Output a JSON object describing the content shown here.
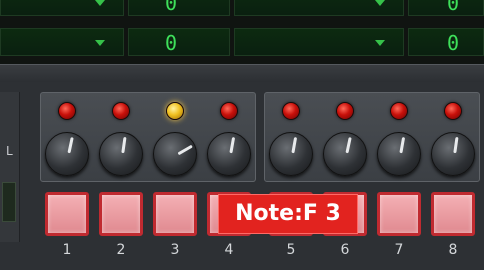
{
  "display": {
    "rows": [
      {
        "value_a": "0",
        "value_b": "0"
      },
      {
        "value_a": "0",
        "value_b": "0"
      }
    ]
  },
  "side_label": "L",
  "groups": [
    {
      "channels": [
        {
          "led": "red",
          "knob": "knob-1"
        },
        {
          "led": "red",
          "knob": "knob-2"
        },
        {
          "led": "amber",
          "knob": "knob-3"
        },
        {
          "led": "red",
          "knob": "knob-4"
        }
      ]
    },
    {
      "channels": [
        {
          "led": "red",
          "knob": "knob-5"
        },
        {
          "led": "red",
          "knob": "knob-6"
        },
        {
          "led": "red",
          "knob": "knob-7"
        },
        {
          "led": "red",
          "knob": "knob-8"
        }
      ]
    }
  ],
  "pads": [
    "1",
    "2",
    "3",
    "4",
    "5",
    "6",
    "7",
    "8"
  ],
  "tooltip": "Note:F 3",
  "colors": {
    "lcd_text": "#3ee05a",
    "led_red": "#c8100a",
    "led_amber": "#f0c020",
    "pad_fill": "#f4b0b4",
    "pad_border": "#c02a30",
    "tooltip_bg": "#e2231f"
  }
}
